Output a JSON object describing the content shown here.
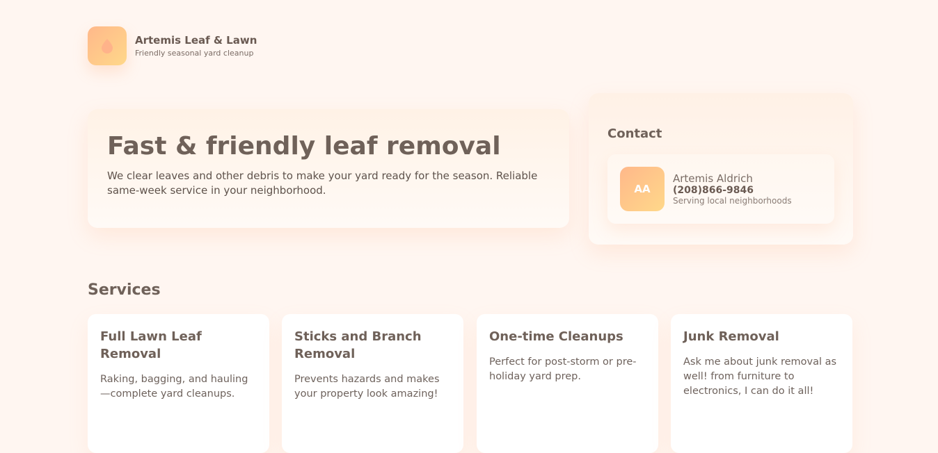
{
  "brand": {
    "name": "Artemis Leaf & Lawn",
    "tagline": "Friendly seasonal yard cleanup",
    "logo_icon": "leaf-drop-icon"
  },
  "hero": {
    "title": "Fast & friendly leaf removal",
    "text": "We clear leaves and other debris to make your yard ready for the season. Reliable same-week service in your neighborhood."
  },
  "contact": {
    "title": "Contact",
    "avatar_initials": "AA",
    "name": "Artemis Aldrich",
    "phone": "(208)866-9846",
    "note": "Serving local neighborhoods"
  },
  "services": {
    "title": "Services",
    "items": [
      {
        "title": "Full Lawn Leaf Removal",
        "description": "Raking, bagging, and hauling—complete yard cleanups."
      },
      {
        "title": "Sticks and Branch Removal",
        "description": "Prevents hazards and makes your property look amazing!"
      },
      {
        "title": "One-time Cleanups",
        "description": "Perfect for post-storm or pre-holiday yard prep."
      },
      {
        "title": "Junk Removal",
        "description": "Ask me about junk removal as well! from furniture to electronics, I can do it all!"
      }
    ]
  },
  "colors": {
    "background": "#fff6f1",
    "accent_start": "#ffb88a",
    "accent_end": "#ffd88a",
    "text": "#6f6159"
  }
}
